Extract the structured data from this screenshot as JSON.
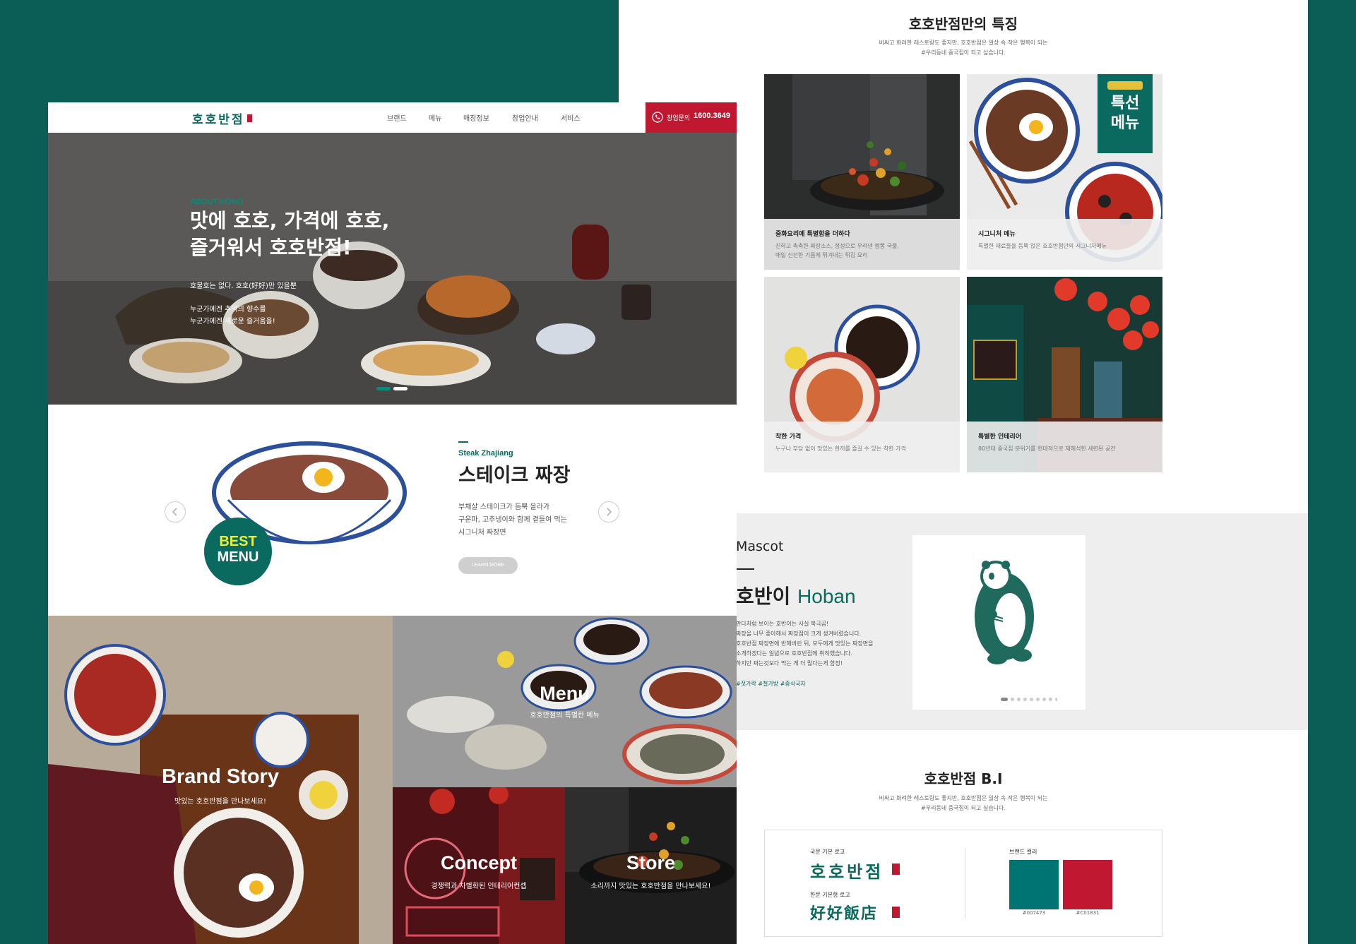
{
  "colors": {
    "bg_teal": "#0a5e55",
    "brand_teal": "#007473",
    "brand_red": "#C01831"
  },
  "left": {
    "header": {
      "logo_text": "호호반점",
      "nav": [
        "브랜드",
        "메뉴",
        "매장정보",
        "창업안내",
        "서비스"
      ],
      "cta_icon": "phone-icon",
      "cta_label": "창업문의",
      "cta_phone": "1600.3649"
    },
    "hero": {
      "eyebrow": "ABOUT HOHO",
      "title_line1": "맛에 호호, 가격에 호호,",
      "title_line2": "즐거워서 호호반점!",
      "desc1": "호불호는 없다. 호호(好好)만 있을뿐",
      "desc2_line1": "누군가에겐 추억의 향수를",
      "desc2_line2": "누군가에겐 새로운 즐거움을!"
    },
    "best": {
      "badge_line1": "BEST",
      "badge_line2": "MENU",
      "eyebrow": "Steak Zhajiang",
      "title": "스테이크 짜장",
      "desc_line1": "부채살 스테이크가 듬뿍 올라가",
      "desc_line2": "구운파, 고추냉이와 함께 곁들여 먹는",
      "desc_line3": "시그니처 짜장면",
      "button": "LEARN MORE",
      "prev_icon": "chevron-left-icon",
      "next_icon": "chevron-right-icon"
    },
    "tiles": {
      "brand_title": "Brand Story",
      "brand_sub": "맛있는 호호반점을 만나보세요!",
      "menu_title": "Menu",
      "menu_sub": "호호반점의 특별한 메뉴",
      "concept_title": "Concept",
      "concept_sub": "경쟁력과 차별화된 인테리어컨셉",
      "store_title": "Store",
      "store_sub": "소리까지 맛있는 호호반점을 만나보세요!"
    }
  },
  "right": {
    "features": {
      "title": "호호반점만의 특징",
      "sub_line1": "비싸고 화려한 레스토랑도 좋지만, 호호반점은 일상 속 작은 행복이 되는",
      "sub_line2": "#우리동네 중국집이 되고 싶습니다.",
      "badge_line1": "특선",
      "badge_line2": "메뉴",
      "cards": [
        {
          "title": "중화요리에 특별함을 더하다",
          "desc_line1": "진하고 촉촉한 짜장소스, 정성으로 우려낸 짬뽕 국물,",
          "desc_line2": "매일 신선한 기름에 튀겨내는 튀김 요리"
        },
        {
          "title": "시그니처 메뉴",
          "desc_line1": "특별한 재료들을 듬뿍 얹은 호호반점만의 시그니처메뉴",
          "desc_line2": ""
        },
        {
          "title": "착한 가격",
          "desc_line1": "누구나 부담 없이 맛있는 한끼를 즐길 수 있는 착한 가격",
          "desc_line2": ""
        },
        {
          "title": "특별한 인테리어",
          "desc_line1": "80년대 중국집 분위기를 현대적으로 재해석한 세련된 공간",
          "desc_line2": ""
        }
      ]
    },
    "mascot": {
      "eyebrow": "Mascot",
      "name_kr": "호반이",
      "name_en": "Hoban",
      "desc": [
        "판다처럼 보이는 호반이는 사실 북극곰!",
        "짜장을 너무 좋아해서 짜장점이 크게 생겨버렸습니다.",
        "호호반점 짜장면에 반해버린 뒤, 모두에게 맛있는 짜장면을",
        "소개하겠다는 일념으로 호호반점에 취직했습니다.",
        "하지만 짜는것보다 먹는 게 더 많다는게 함정!"
      ],
      "tags": "#젓가락 #철가방 #중식국자",
      "dots": 9,
      "active_dot": 0
    },
    "bi": {
      "title": "호호반점 B.I",
      "sub_line1": "비싸고 화려한 레스토랑도 좋지만, 호호반점은 일상 속 작은 행복이 되는",
      "sub_line2": "#우리동네 중국집이 되고 싶습니다.",
      "kr_logo_label": "국문 기본 로고",
      "kr_logo": "호호반점",
      "cn_logo_label": "한문 기본형 로고",
      "cn_logo": "好好飯店",
      "color_label": "브랜드 컬러",
      "swatches": [
        "#007473",
        "#C01831"
      ]
    }
  }
}
